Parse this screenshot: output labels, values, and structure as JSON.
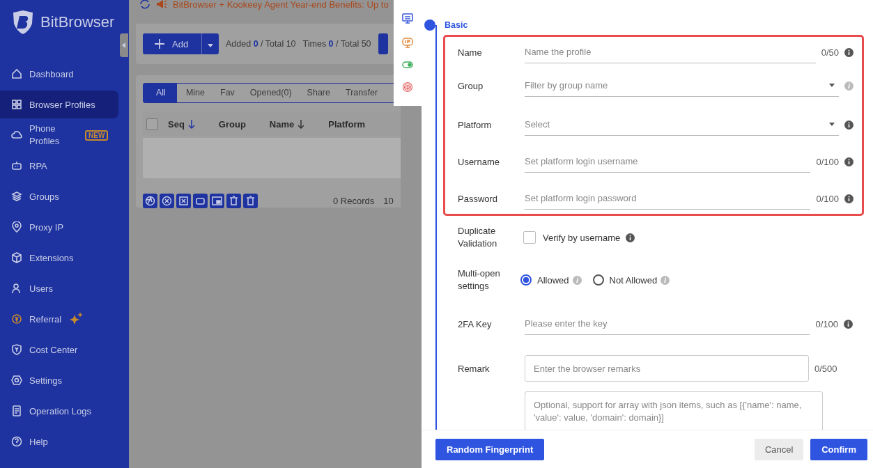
{
  "sidebar": {
    "logo_text": "BitBrowser",
    "items": [
      {
        "label": "Dashboard",
        "selected": false
      },
      {
        "label": "Browser Profiles",
        "selected": true
      },
      {
        "label": "Phone Profiles",
        "selected": false,
        "badge": "NEW"
      },
      {
        "label": "RPA",
        "selected": false
      },
      {
        "label": "Groups",
        "selected": false
      },
      {
        "label": "Proxy IP",
        "selected": false
      },
      {
        "label": "Extensions",
        "selected": false
      },
      {
        "label": "Users",
        "selected": false
      },
      {
        "label": "Referral",
        "selected": false
      },
      {
        "label": "Cost Center",
        "selected": false
      },
      {
        "label": "Settings",
        "selected": false
      },
      {
        "label": "Operation Logs",
        "selected": false
      },
      {
        "label": "Help",
        "selected": false
      }
    ]
  },
  "announcement": "BitBrowser + Kookeey Agent Year-end Benefits: Up to",
  "toolbar": {
    "add_button": "Add",
    "stats": [
      {
        "label": "Added",
        "value": "0",
        "total": "/ Total 10"
      },
      {
        "label": "Times",
        "value": "0",
        "total": "/ Total 50"
      }
    ]
  },
  "tabs": [
    {
      "label": "All",
      "selected": true
    },
    {
      "label": "Mine",
      "selected": false
    },
    {
      "label": "Fav",
      "selected": false
    },
    {
      "label": "Opened(0)",
      "selected": false
    },
    {
      "label": "Share",
      "selected": false
    },
    {
      "label": "Transfer",
      "selected": false
    }
  ],
  "table": {
    "select_all_checked": false,
    "columns": [
      {
        "label": "Seq",
        "sortable": true
      },
      {
        "label": "Group",
        "sortable": false
      },
      {
        "label": "Name",
        "sortable": true
      },
      {
        "label": "Platform",
        "sortable": false
      }
    ]
  },
  "footer": {
    "records": "0 Records",
    "page_size": "10"
  },
  "drawer": {
    "section": "Basic",
    "highlighted_fields": [
      {
        "kind": "text",
        "label": "Name",
        "placeholder": "Name the profile",
        "counter": "0/50",
        "info_muted": false
      },
      {
        "kind": "select",
        "label": "Group",
        "placeholder": "Filter by group name",
        "info_muted": true
      },
      {
        "kind": "select",
        "label": "Platform",
        "placeholder": "Select",
        "info_muted": false
      },
      {
        "kind": "text",
        "label": "Username",
        "placeholder": "Set platform login username",
        "counter": "0/100",
        "info_muted": false
      },
      {
        "kind": "text",
        "label": "Password",
        "placeholder": "Set platform login password",
        "counter": "0/100",
        "info_muted": false
      }
    ],
    "fields": [
      {
        "kind": "checkbox",
        "label": "Duplicate Validation",
        "option": "Verify by username",
        "checked": false,
        "info_muted": false
      },
      {
        "kind": "radio",
        "label": "Multi-open settings",
        "options": [
          {
            "label": "Allowed",
            "selected": true
          },
          {
            "label": "Not Allowed",
            "selected": false
          }
        ]
      },
      {
        "kind": "text",
        "label": "2FA Key",
        "placeholder": "Please enter the key",
        "counter": "0/100",
        "info_muted": false
      },
      {
        "kind": "box",
        "label": "Remark",
        "placeholder": "Enter the browser remarks",
        "counter": "0/500"
      },
      {
        "kind": "textarea",
        "placeholder": "Optional, support for array with json items, such as [{'name': name, 'value': value, 'domain': domain}]"
      }
    ],
    "buttons": {
      "random": "Random Fingerprint",
      "cancel": "Cancel",
      "confirm": "Confirm"
    }
  }
}
